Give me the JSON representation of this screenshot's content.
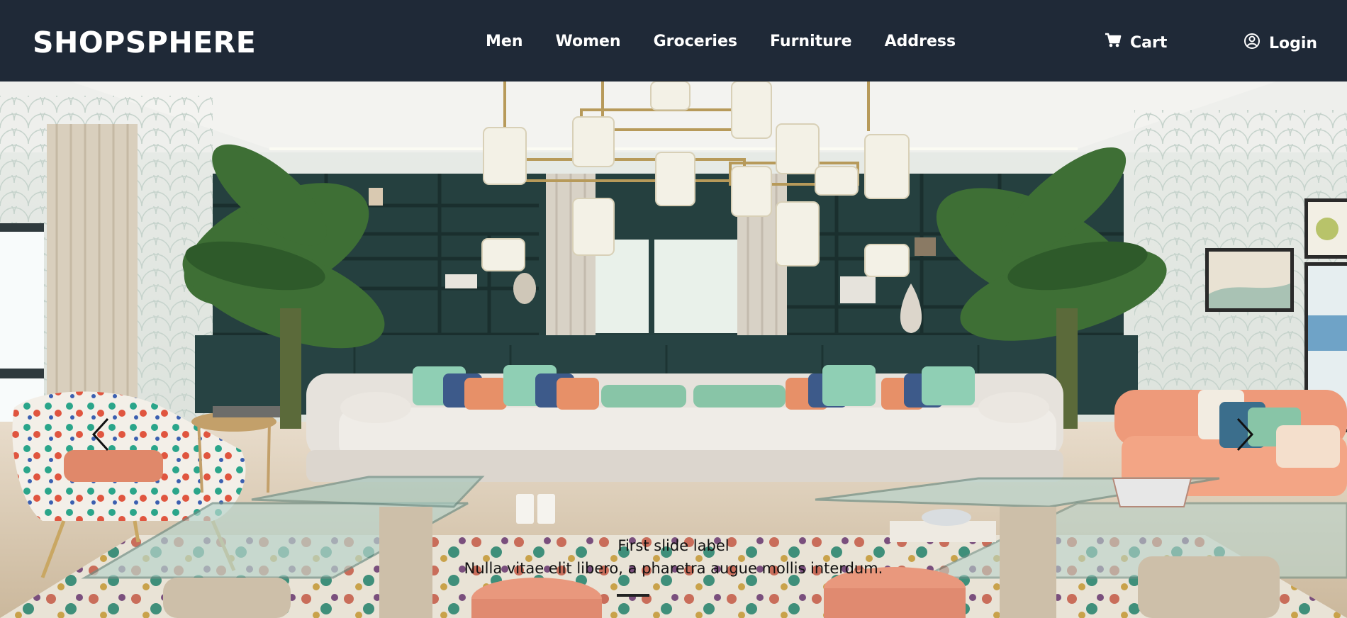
{
  "brand": "SHOPSPHERE",
  "nav": {
    "links": [
      "Men",
      "Women",
      "Groceries",
      "Furniture",
      "Address"
    ],
    "cart_label": "Cart",
    "login_label": "Login"
  },
  "icons": {
    "cart": "cart-icon",
    "login": "user-circle-icon",
    "prev": "chevron-left-icon",
    "next": "chevron-right-icon"
  },
  "carousel": {
    "caption_title": "First slide label",
    "caption_text": "Nulla vitae elit libero, a pharetra augue mollis interdum.",
    "active_index": 1,
    "total_indicators": 1
  },
  "colors": {
    "navbar": "#1f2937",
    "text": "#ffffff"
  }
}
